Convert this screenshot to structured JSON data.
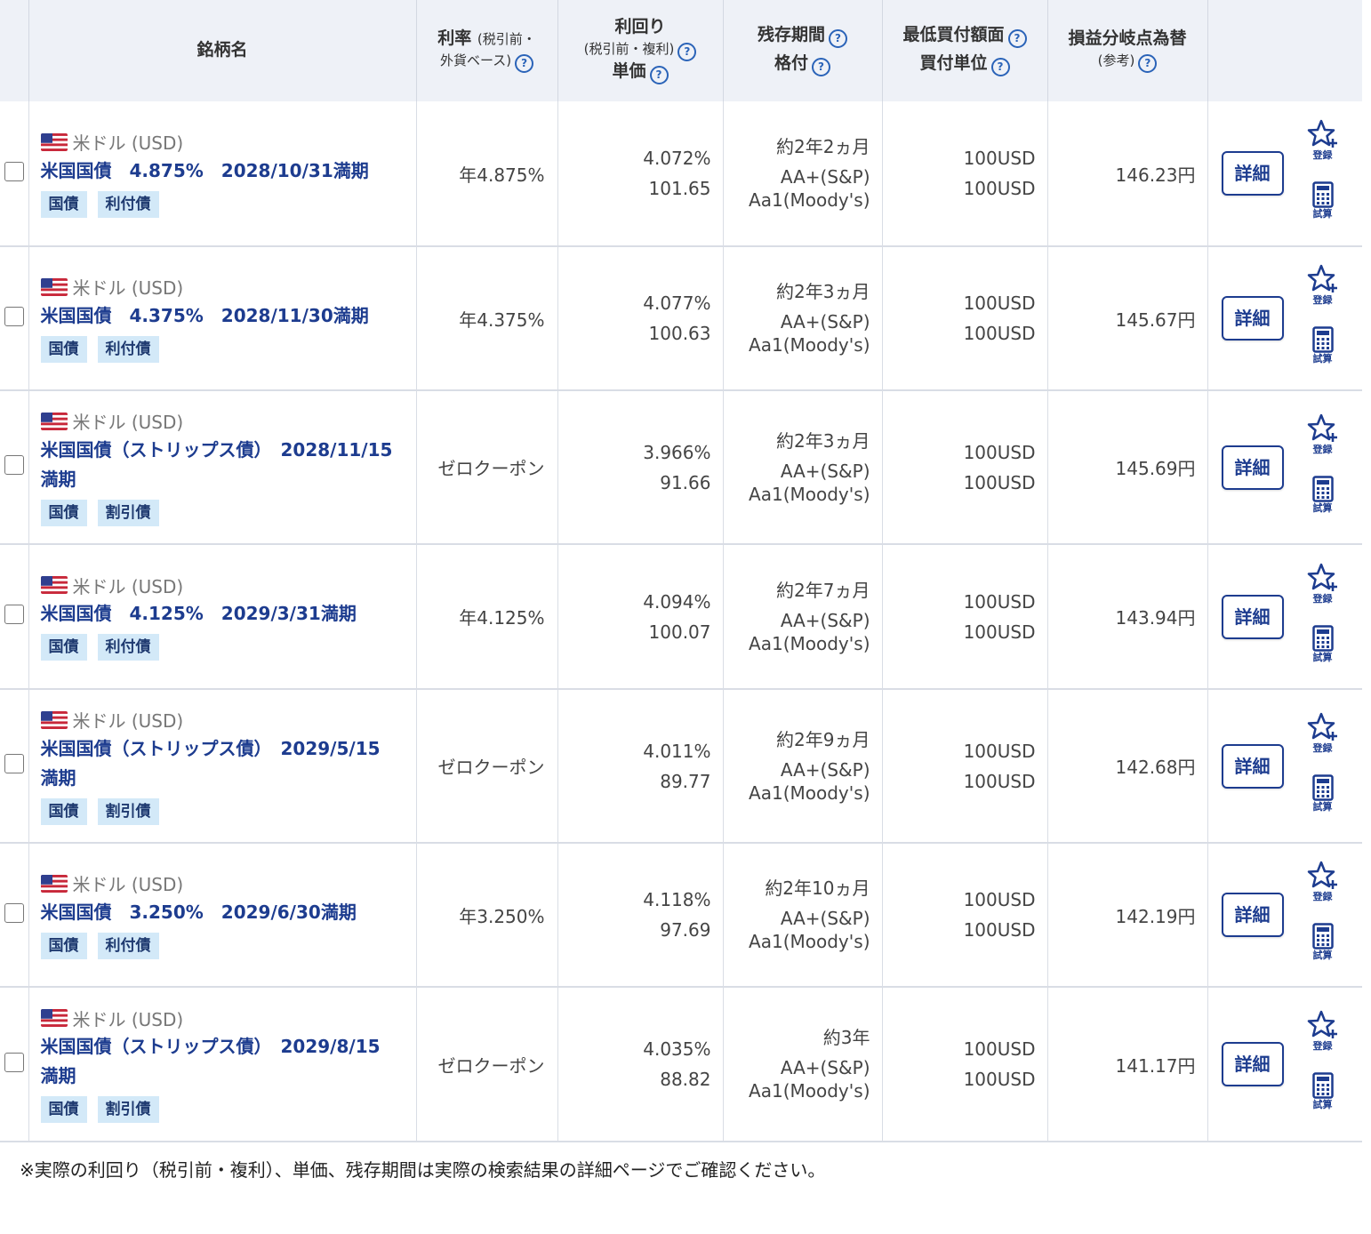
{
  "headers": {
    "name": "銘柄名",
    "rate_main": "利率",
    "rate_sub1": "(税引前・",
    "rate_sub2": "外貨ベース)",
    "yield_main": "利回り",
    "yield_sub": "(税引前・複利)",
    "price": "単価",
    "term": "残存期間",
    "rating": "格付",
    "min_amount": "最低買付額面",
    "unit": "買付単位",
    "breakeven": "損益分岐点為替",
    "breakeven_sub": "(参考)"
  },
  "actions": {
    "detail_label": "詳細",
    "register_label": "登録",
    "calc_label": "試算"
  },
  "rows": [
    {
      "currency": "米ドル (USD)",
      "name": "米国国債　4.875%　2028/10/31満期",
      "tags": [
        "国債",
        "利付債"
      ],
      "rate": "年4.875%",
      "yield": "4.072%",
      "price": "101.65",
      "term": "約2年2ヵ月",
      "rating_sp": "AA+(S&P)",
      "rating_moodys": "Aa1(Moody's)",
      "min_amount": "100USD",
      "unit": "100USD",
      "breakeven": "146.23円"
    },
    {
      "currency": "米ドル (USD)",
      "name": "米国国債　4.375%　2028/11/30満期",
      "tags": [
        "国債",
        "利付債"
      ],
      "rate": "年4.375%",
      "yield": "4.077%",
      "price": "100.63",
      "term": "約2年3ヵ月",
      "rating_sp": "AA+(S&P)",
      "rating_moodys": "Aa1(Moody's)",
      "min_amount": "100USD",
      "unit": "100USD",
      "breakeven": "145.67円"
    },
    {
      "currency": "米ドル (USD)",
      "name": "米国国債（ストリップス債）　2028/11/15\n満期",
      "tags": [
        "国債",
        "割引債"
      ],
      "rate": "ゼロクーポン",
      "yield": "3.966%",
      "price": "91.66",
      "term": "約2年3ヵ月",
      "rating_sp": "AA+(S&P)",
      "rating_moodys": "Aa1(Moody's)",
      "min_amount": "100USD",
      "unit": "100USD",
      "breakeven": "145.69円"
    },
    {
      "currency": "米ドル (USD)",
      "name": "米国国債　4.125%　2029/3/31満期",
      "tags": [
        "国債",
        "利付債"
      ],
      "rate": "年4.125%",
      "yield": "4.094%",
      "price": "100.07",
      "term": "約2年7ヵ月",
      "rating_sp": "AA+(S&P)",
      "rating_moodys": "Aa1(Moody's)",
      "min_amount": "100USD",
      "unit": "100USD",
      "breakeven": "143.94円"
    },
    {
      "currency": "米ドル (USD)",
      "name": "米国国債（ストリップス債）　2029/5/15\n満期",
      "tags": [
        "国債",
        "割引債"
      ],
      "rate": "ゼロクーポン",
      "yield": "4.011%",
      "price": "89.77",
      "term": "約2年9ヵ月",
      "rating_sp": "AA+(S&P)",
      "rating_moodys": "Aa1(Moody's)",
      "min_amount": "100USD",
      "unit": "100USD",
      "breakeven": "142.68円"
    },
    {
      "currency": "米ドル (USD)",
      "name": "米国国債　3.250%　2029/6/30満期",
      "tags": [
        "国債",
        "利付債"
      ],
      "rate": "年3.250%",
      "yield": "4.118%",
      "price": "97.69",
      "term": "約2年10ヵ月",
      "rating_sp": "AA+(S&P)",
      "rating_moodys": "Aa1(Moody's)",
      "min_amount": "100USD",
      "unit": "100USD",
      "breakeven": "142.19円"
    },
    {
      "currency": "米ドル (USD)",
      "name": "米国国債（ストリップス債）　2029/8/15\n満期",
      "tags": [
        "国債",
        "割引債"
      ],
      "rate": "ゼロクーポン",
      "yield": "4.035%",
      "price": "88.82",
      "term": "約3年",
      "rating_sp": "AA+(S&P)",
      "rating_moodys": "Aa1(Moody's)",
      "min_amount": "100USD",
      "unit": "100USD",
      "breakeven": "141.17円"
    }
  ],
  "note": "※実際の利回り（税引前・複利）、単価、残存期間は実際の検索結果の詳細ページでご確認ください。",
  "colors": {
    "header_bg": "#eef1f7",
    "name_blue": "#1d3c8f",
    "tag_bg": "#d3e9f8",
    "help_blue": "#2a63b8"
  },
  "icons": [
    "us-flag-icon",
    "help-icon",
    "star-plus-icon",
    "calculator-icon"
  ]
}
